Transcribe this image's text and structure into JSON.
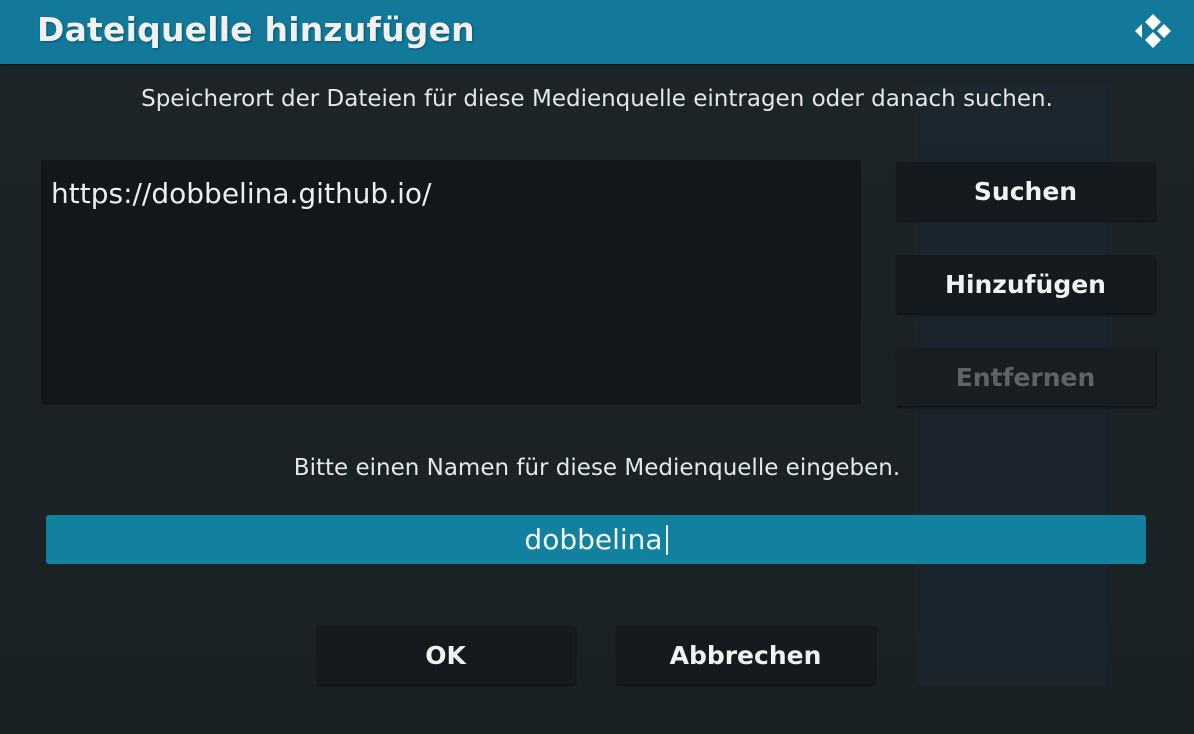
{
  "window": {
    "title": "Dateiquelle hinzufügen",
    "logo_icon": "kodi-logo-icon"
  },
  "source": {
    "instruction": "Speicherort der Dateien für diese Medienquelle eintragen oder danach suchen.",
    "paths": [
      "https://dobbelina.github.io/"
    ]
  },
  "actions": {
    "browse_label": "Suchen",
    "add_label": "Hinzufügen",
    "remove_label": "Entfernen"
  },
  "name": {
    "instruction": "Bitte einen Namen für diese Medienquelle eingeben.",
    "value": "dobbelina"
  },
  "footer": {
    "ok_label": "OK",
    "cancel_label": "Abbrechen"
  },
  "colors": {
    "header": "#12799a",
    "input_focus": "#12809f",
    "background": "#1b2226",
    "button": "#141a1d",
    "disabled_text": "#5e6366"
  }
}
